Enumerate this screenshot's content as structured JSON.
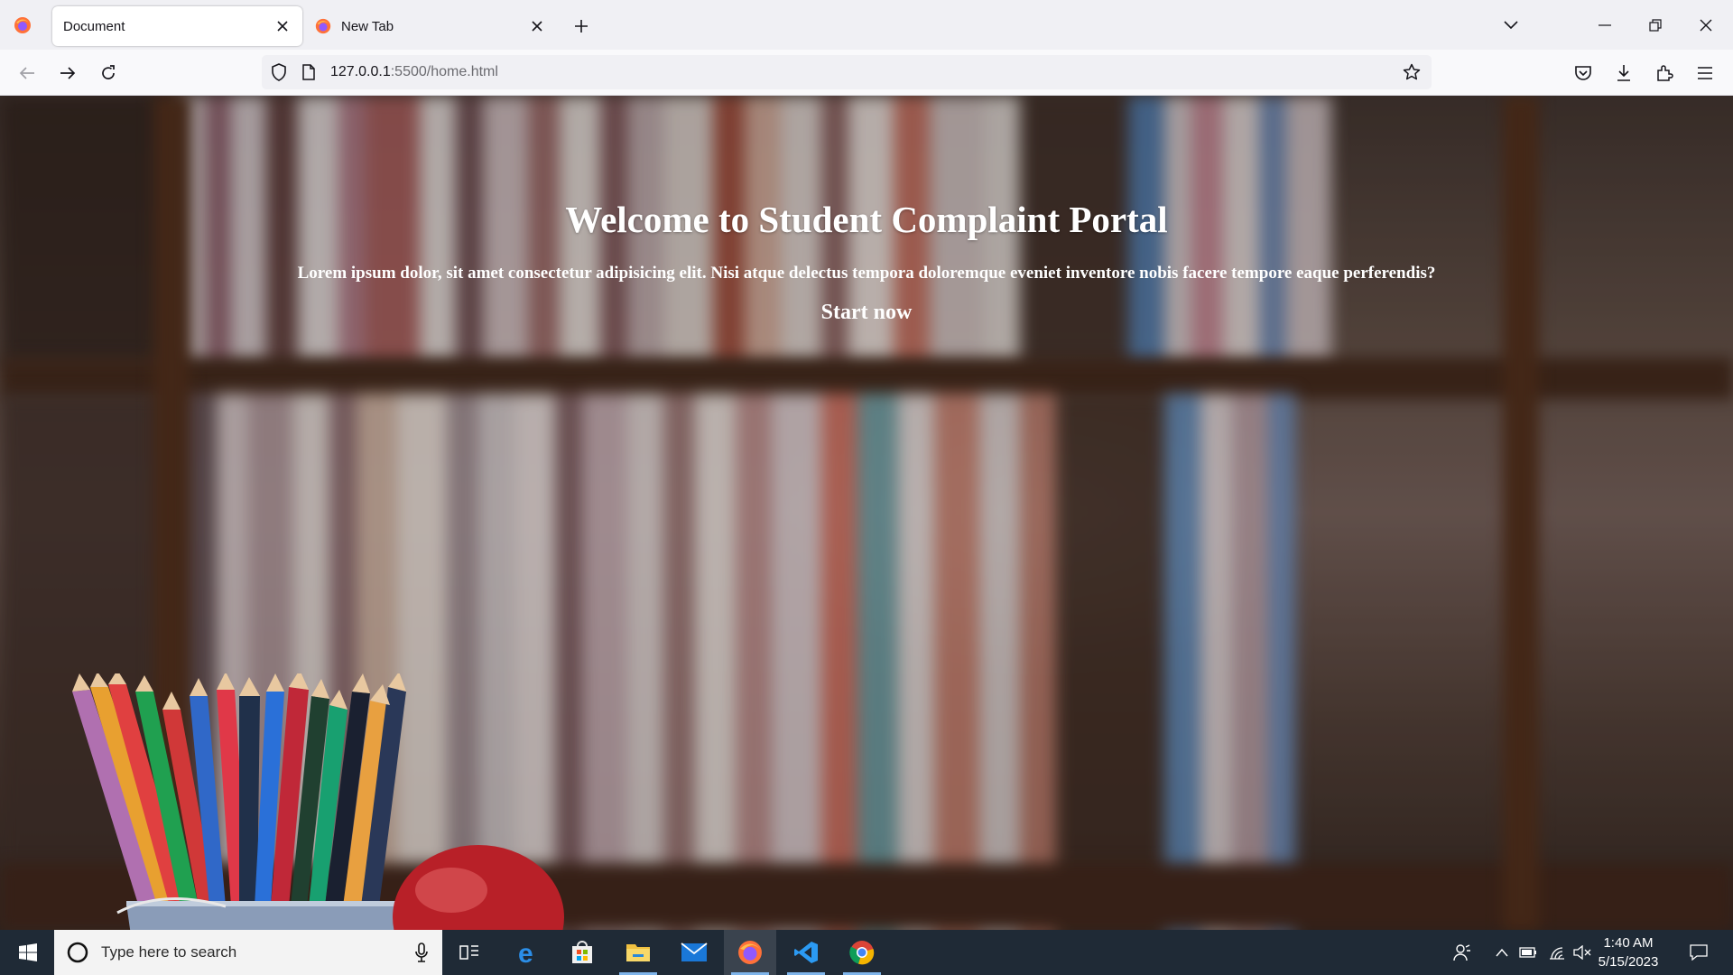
{
  "browser": {
    "tabs": [
      {
        "title": "Document",
        "active": true
      },
      {
        "title": "New Tab",
        "active": false
      }
    ],
    "url": {
      "host": "127.0.0.1",
      "rest": ":5500/home.html"
    }
  },
  "page": {
    "heading": "Welcome to Student Complaint Portal",
    "subtext": "Lorem ipsum dolor, sit amet consectetur adipisicing elit. Nisi atque delectus tempora doloremque eveniet inventore nobis facere tempore eaque perferendis?",
    "cta_label": "Start now"
  },
  "taskbar": {
    "search_placeholder": "Type here to search",
    "time": "1:40 AM",
    "date": "5/15/2023",
    "pinned_apps": [
      "task-view",
      "edge",
      "microsoft-store",
      "file-explorer",
      "mail",
      "firefox",
      "vscode",
      "chrome"
    ]
  },
  "colors": {
    "chrome_bg": "#f0f0f4",
    "navbar_bg": "#f9f9fb",
    "taskbar_bg": "#1f2a36",
    "hero_text": "#ffffff"
  }
}
